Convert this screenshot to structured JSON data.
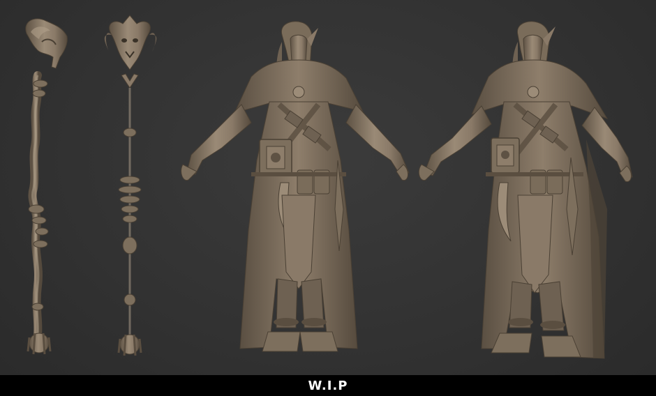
{
  "caption": {
    "text": "W.I.P"
  },
  "colors": {
    "background": "#333333",
    "sculpt_clay": "#8a7a68",
    "sculpt_shadow": "#4e4438",
    "sculpt_highlight": "#b2a38e",
    "caption_bar": "#000000",
    "caption_text": "#ffffff"
  },
  "figures": [
    {
      "name": "staff-side-view"
    },
    {
      "name": "staff-front-view"
    },
    {
      "name": "character-front-view"
    },
    {
      "name": "character-three-quarter-view"
    }
  ]
}
